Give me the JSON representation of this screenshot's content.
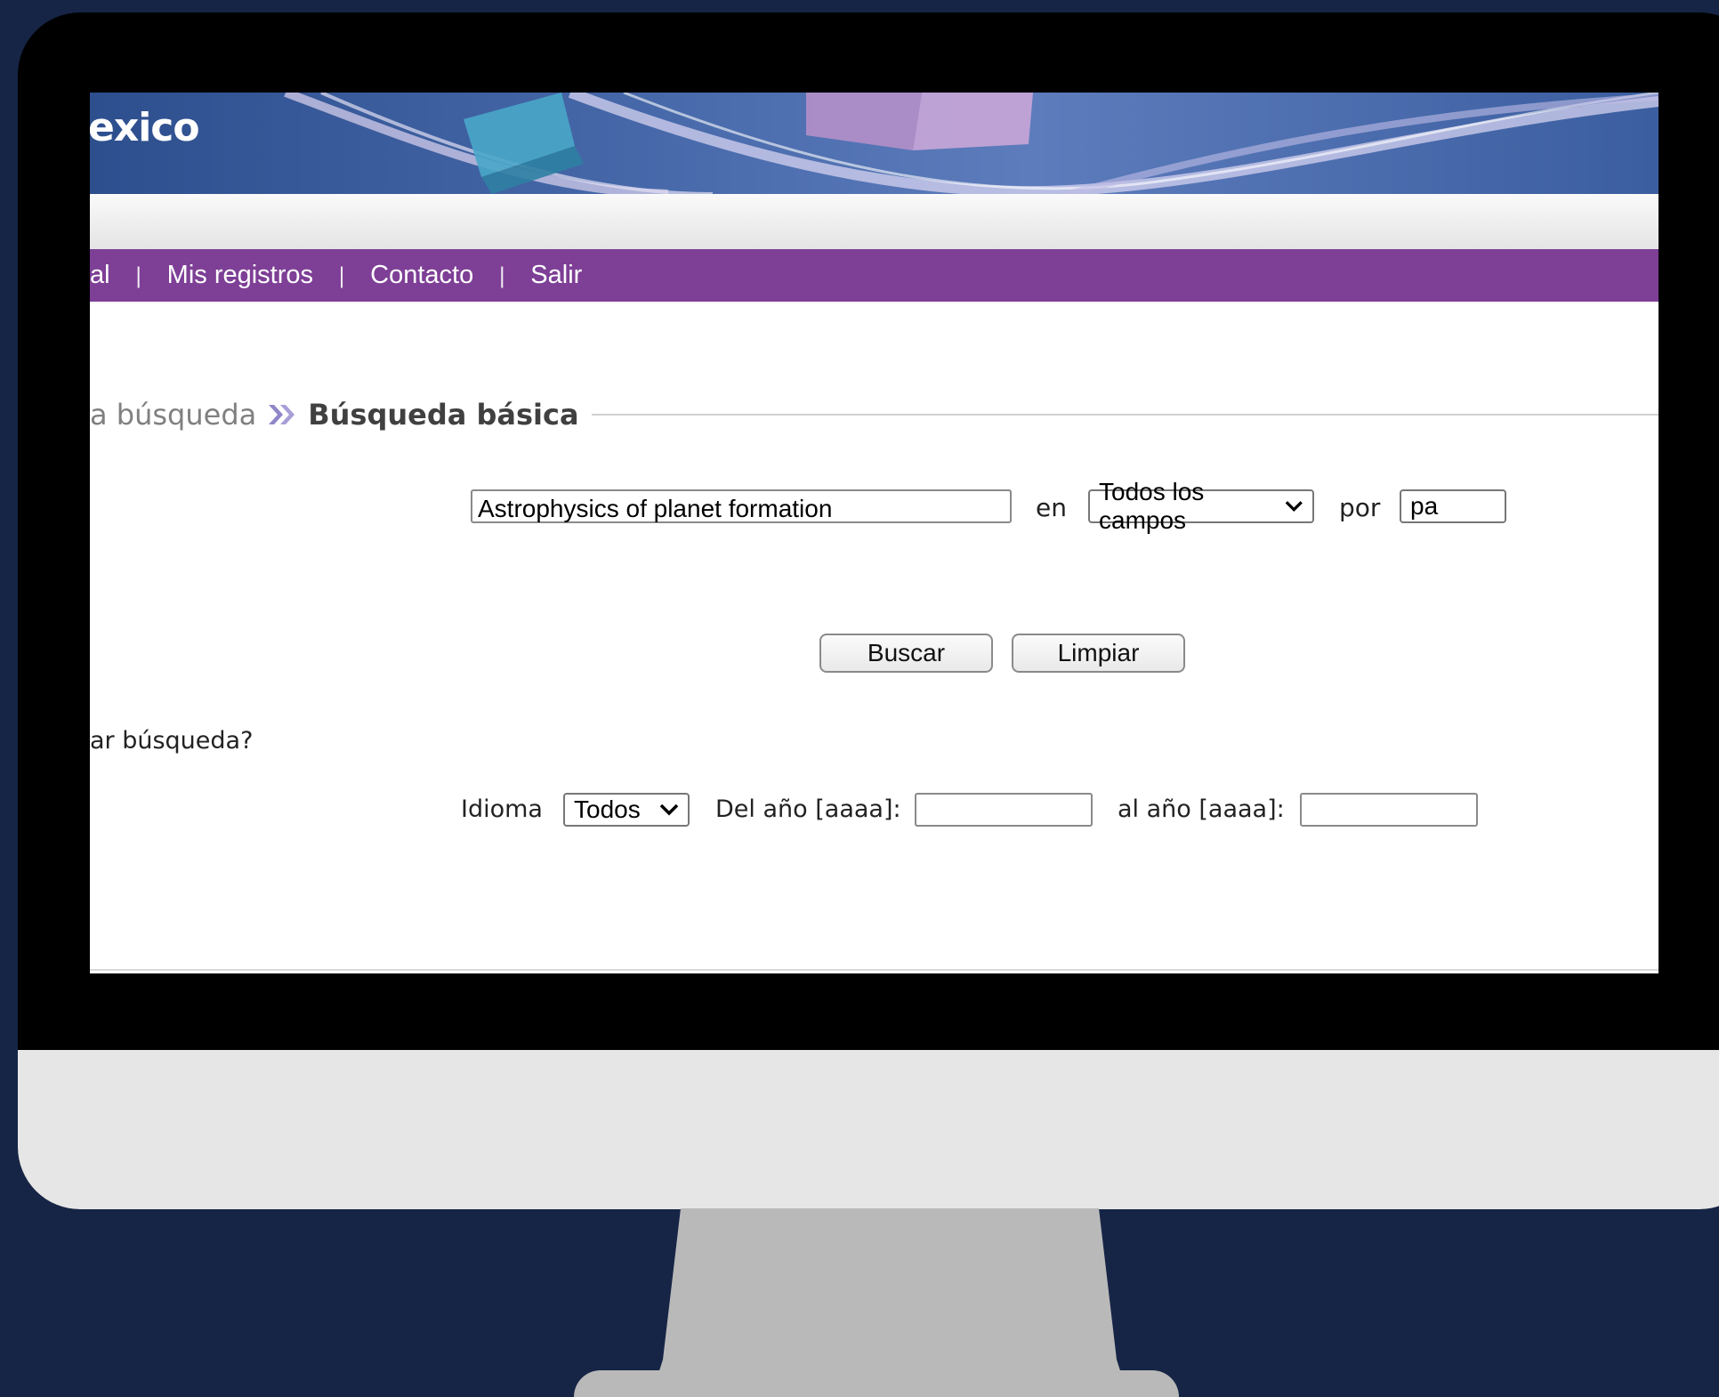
{
  "banner": {
    "title": "exico"
  },
  "nav": {
    "items": [
      "al",
      "Mis registros",
      "Contacto",
      "Salir"
    ],
    "separator": "|"
  },
  "breadcrumb": {
    "previous": "a búsqueda",
    "current": "Búsqueda básica"
  },
  "search": {
    "query": "Astrophysics of planet formation",
    "in_label": "en",
    "field_selected": "Todos los campos",
    "by_label": "por",
    "by_selected": "pa"
  },
  "buttons": {
    "search": "Buscar",
    "clear": "Limpiar"
  },
  "refine": {
    "question": "ar búsqueda?",
    "language_label": "Idioma",
    "language_selected": "Todos",
    "from_year_label": "Del año [aaaa]:",
    "from_year_value": "",
    "to_year_label": "al año [aaaa]:",
    "to_year_value": ""
  },
  "colors": {
    "nav_bar": "#7e3f96",
    "background": "#162546",
    "banner": "#4668a9"
  }
}
